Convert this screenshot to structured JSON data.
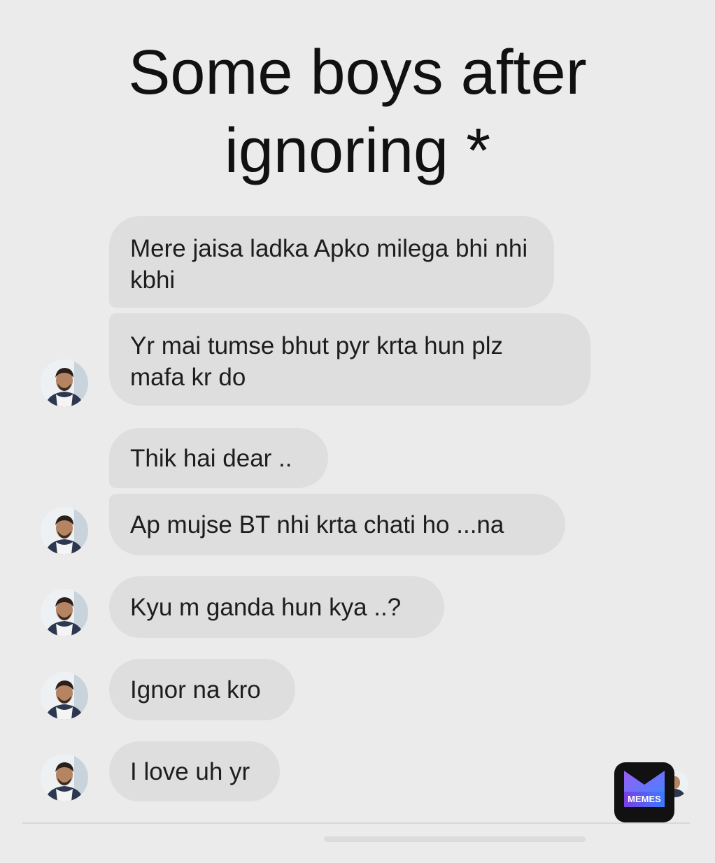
{
  "caption": {
    "line1": "Some boys after",
    "line2": "ignoring *"
  },
  "messages": [
    {
      "text": "Mere jaisa ladka Apko milega bhi nhi kbhi"
    },
    {
      "text": "Yr mai tumse bhut pyr krta hun plz mafa kr do"
    },
    {
      "text": "Thik hai dear .."
    },
    {
      "text": "Ap mujse BT nhi krta chati ho ...na"
    },
    {
      "text": "Kyu m ganda hun kya ..?"
    },
    {
      "text": "Ignor na kro"
    },
    {
      "text": "I love uh yr"
    }
  ],
  "watermark": {
    "label": "MEMES",
    "icon": "memes-logo-icon"
  },
  "colors": {
    "background": "#ebebeb",
    "bubble": "#dedede",
    "text": "#1d1d1d"
  }
}
